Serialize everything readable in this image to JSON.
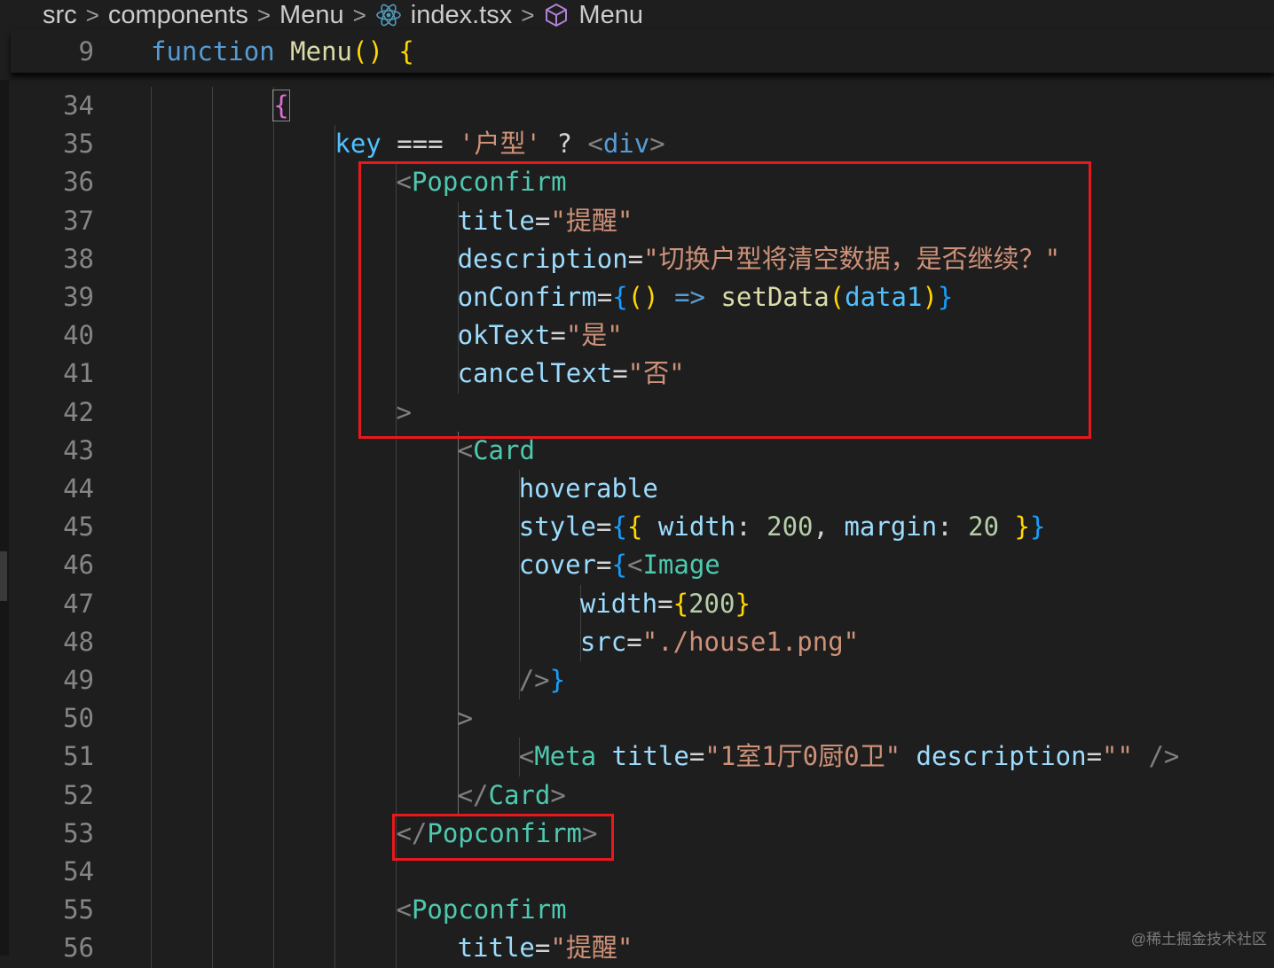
{
  "breadcrumb": {
    "items": [
      {
        "label": "src"
      },
      {
        "label": "components"
      },
      {
        "label": "Menu"
      },
      {
        "label": "index.tsx",
        "icon": "react-icon"
      },
      {
        "label": "Menu",
        "icon": "cube-icon"
      }
    ],
    "separator": ">"
  },
  "sticky": {
    "line_number": "9",
    "tokens": [
      {
        "t": "function",
        "c": "kw"
      },
      {
        "t": " ",
        "c": "op"
      },
      {
        "t": "Menu",
        "c": "fn"
      },
      {
        "t": "()",
        "c": "br1"
      },
      {
        "t": " ",
        "c": "op"
      },
      {
        "t": "{",
        "c": "br1"
      }
    ]
  },
  "lines": [
    {
      "n": "34",
      "indent": 4,
      "tokens": [
        {
          "t": "{",
          "c": "br2",
          "box": true
        }
      ]
    },
    {
      "n": "35",
      "indent": 6,
      "tokens": [
        {
          "t": "key",
          "c": "var"
        },
        {
          "t": " === ",
          "c": "op"
        },
        {
          "t": "'户型'",
          "c": "str"
        },
        {
          "t": " ? ",
          "c": "op"
        },
        {
          "t": "<",
          "c": "punct"
        },
        {
          "t": "div",
          "c": "ptag"
        },
        {
          "t": ">",
          "c": "punct"
        }
      ]
    },
    {
      "n": "36",
      "indent": 8,
      "tokens": [
        {
          "t": "<",
          "c": "punct"
        },
        {
          "t": "Popconfirm",
          "c": "tag"
        }
      ]
    },
    {
      "n": "37",
      "indent": 10,
      "tokens": [
        {
          "t": "title",
          "c": "attr"
        },
        {
          "t": "=",
          "c": "op"
        },
        {
          "t": "\"提醒\"",
          "c": "str"
        }
      ]
    },
    {
      "n": "38",
      "indent": 10,
      "tokens": [
        {
          "t": "description",
          "c": "attr"
        },
        {
          "t": "=",
          "c": "op"
        },
        {
          "t": "\"切换户型将清空数据，是否继续？\"",
          "c": "str"
        }
      ]
    },
    {
      "n": "39",
      "indent": 10,
      "tokens": [
        {
          "t": "onConfirm",
          "c": "attr"
        },
        {
          "t": "=",
          "c": "op"
        },
        {
          "t": "{",
          "c": "br3"
        },
        {
          "t": "()",
          "c": "br1"
        },
        {
          "t": " ",
          "c": "op"
        },
        {
          "t": "=>",
          "c": "arrow"
        },
        {
          "t": " ",
          "c": "op"
        },
        {
          "t": "setData",
          "c": "fn"
        },
        {
          "t": "(",
          "c": "br1"
        },
        {
          "t": "data1",
          "c": "var"
        },
        {
          "t": ")",
          "c": "br1"
        },
        {
          "t": "}",
          "c": "br3"
        }
      ]
    },
    {
      "n": "40",
      "indent": 10,
      "tokens": [
        {
          "t": "okText",
          "c": "attr"
        },
        {
          "t": "=",
          "c": "op"
        },
        {
          "t": "\"是\"",
          "c": "str"
        }
      ]
    },
    {
      "n": "41",
      "indent": 10,
      "tokens": [
        {
          "t": "cancelText",
          "c": "attr"
        },
        {
          "t": "=",
          "c": "op"
        },
        {
          "t": "\"否\"",
          "c": "str"
        }
      ]
    },
    {
      "n": "42",
      "indent": 8,
      "tokens": [
        {
          "t": ">",
          "c": "punct"
        }
      ]
    },
    {
      "n": "43",
      "indent": 10,
      "tokens": [
        {
          "t": "<",
          "c": "punct"
        },
        {
          "t": "Card",
          "c": "tag"
        }
      ]
    },
    {
      "n": "44",
      "indent": 12,
      "tokens": [
        {
          "t": "hoverable",
          "c": "attr"
        }
      ]
    },
    {
      "n": "45",
      "indent": 12,
      "tokens": [
        {
          "t": "style",
          "c": "attr"
        },
        {
          "t": "=",
          "c": "op"
        },
        {
          "t": "{",
          "c": "br3"
        },
        {
          "t": "{",
          "c": "br1"
        },
        {
          "t": " ",
          "c": "op"
        },
        {
          "t": "width",
          "c": "attr"
        },
        {
          "t": ": ",
          "c": "op"
        },
        {
          "t": "200",
          "c": "num"
        },
        {
          "t": ", ",
          "c": "op"
        },
        {
          "t": "margin",
          "c": "attr"
        },
        {
          "t": ": ",
          "c": "op"
        },
        {
          "t": "20",
          "c": "num"
        },
        {
          "t": " ",
          "c": "op"
        },
        {
          "t": "}",
          "c": "br1"
        },
        {
          "t": "}",
          "c": "br3"
        }
      ]
    },
    {
      "n": "46",
      "indent": 12,
      "tokens": [
        {
          "t": "cover",
          "c": "attr"
        },
        {
          "t": "=",
          "c": "op"
        },
        {
          "t": "{",
          "c": "br3"
        },
        {
          "t": "<",
          "c": "punct"
        },
        {
          "t": "Image",
          "c": "tag"
        }
      ]
    },
    {
      "n": "47",
      "indent": 14,
      "tokens": [
        {
          "t": "width",
          "c": "attr"
        },
        {
          "t": "=",
          "c": "op"
        },
        {
          "t": "{",
          "c": "br1"
        },
        {
          "t": "200",
          "c": "num"
        },
        {
          "t": "}",
          "c": "br1"
        }
      ]
    },
    {
      "n": "48",
      "indent": 14,
      "tokens": [
        {
          "t": "src",
          "c": "attr"
        },
        {
          "t": "=",
          "c": "op"
        },
        {
          "t": "\"./house1.png\"",
          "c": "str"
        }
      ]
    },
    {
      "n": "49",
      "indent": 12,
      "tokens": [
        {
          "t": "/>",
          "c": "punct"
        },
        {
          "t": "}",
          "c": "br3"
        }
      ]
    },
    {
      "n": "50",
      "indent": 10,
      "tokens": [
        {
          "t": ">",
          "c": "punct"
        }
      ]
    },
    {
      "n": "51",
      "indent": 12,
      "tokens": [
        {
          "t": "<",
          "c": "punct"
        },
        {
          "t": "Meta",
          "c": "tag"
        },
        {
          "t": " ",
          "c": "op"
        },
        {
          "t": "title",
          "c": "attr"
        },
        {
          "t": "=",
          "c": "op"
        },
        {
          "t": "\"1室1厅0厨0卫\"",
          "c": "str"
        },
        {
          "t": " ",
          "c": "op"
        },
        {
          "t": "description",
          "c": "attr"
        },
        {
          "t": "=",
          "c": "op"
        },
        {
          "t": "\"\"",
          "c": "str"
        },
        {
          "t": " ",
          "c": "op"
        },
        {
          "t": "/>",
          "c": "punct"
        }
      ]
    },
    {
      "n": "52",
      "indent": 10,
      "tokens": [
        {
          "t": "</",
          "c": "punct"
        },
        {
          "t": "Card",
          "c": "tag"
        },
        {
          "t": ">",
          "c": "punct"
        }
      ]
    },
    {
      "n": "53",
      "indent": 8,
      "tokens": [
        {
          "t": "</",
          "c": "punct"
        },
        {
          "t": "Popconfirm",
          "c": "tag"
        },
        {
          "t": ">",
          "c": "punct"
        }
      ]
    },
    {
      "n": "54",
      "indent": 0,
      "tokens": []
    },
    {
      "n": "55",
      "indent": 8,
      "tokens": [
        {
          "t": "<",
          "c": "punct"
        },
        {
          "t": "Popconfirm",
          "c": "tag"
        }
      ]
    },
    {
      "n": "56",
      "indent": 10,
      "tokens": [
        {
          "t": "title",
          "c": "attr"
        },
        {
          "t": "=",
          "c": "op"
        },
        {
          "t": "\"提醒\"",
          "c": "str"
        }
      ]
    }
  ],
  "watermark": "@稀土掘金技术社区",
  "colors": {
    "background": "#1e1e1e",
    "highlight_box": "#e8191d",
    "keyword": "#569cd6",
    "function": "#dcdcaa",
    "string": "#ce9178",
    "component_tag": "#4ec9b0",
    "attribute": "#9cdcfe"
  }
}
